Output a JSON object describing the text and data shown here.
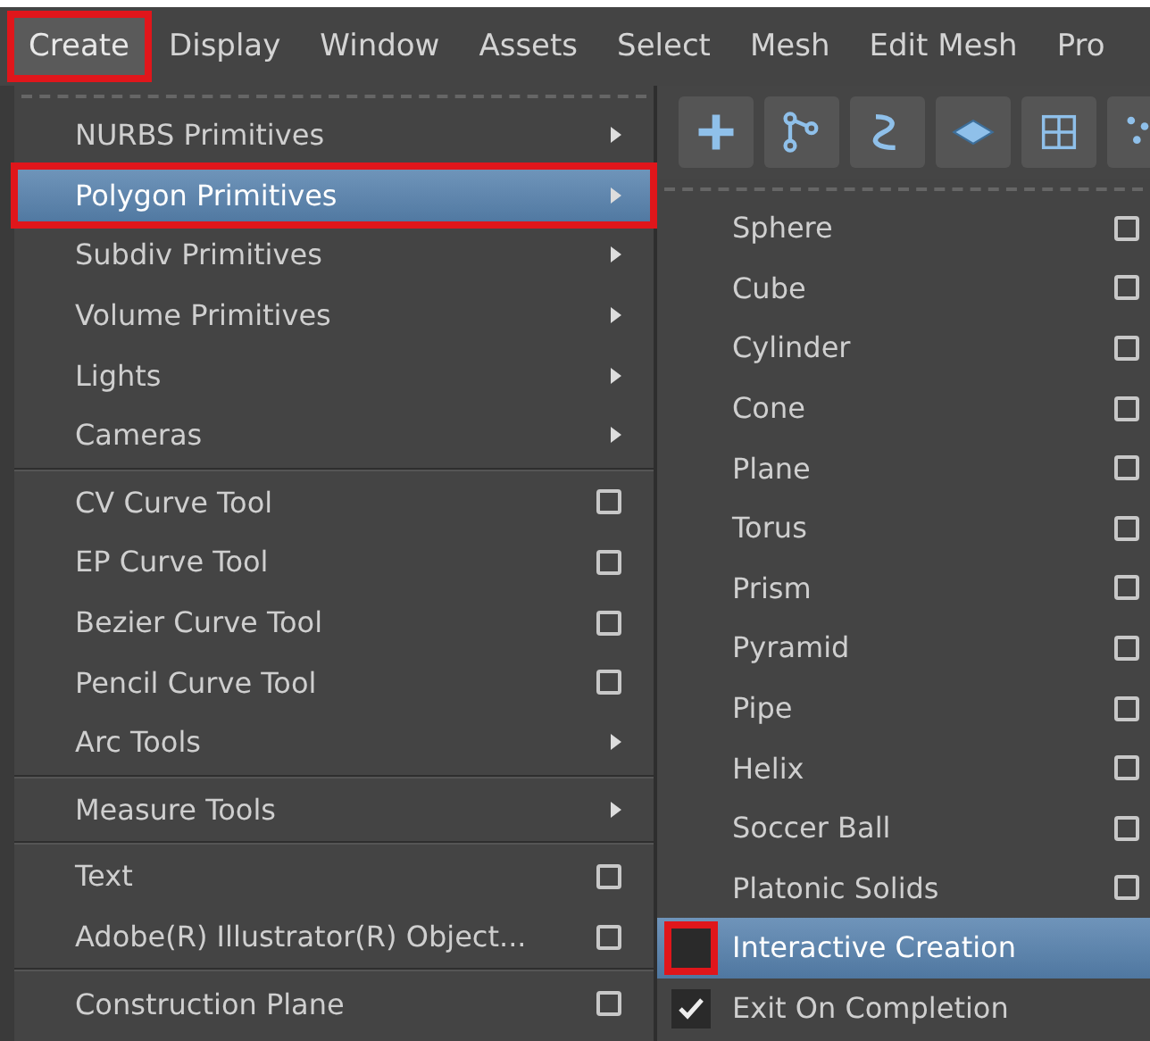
{
  "menu_bar": [
    {
      "label": "Create",
      "selected": true,
      "annotated": true
    },
    {
      "label": "Display",
      "selected": false,
      "annotated": false
    },
    {
      "label": "Window",
      "selected": false,
      "annotated": false
    },
    {
      "label": "Assets",
      "selected": false,
      "annotated": false
    },
    {
      "label": "Select",
      "selected": false,
      "annotated": false
    },
    {
      "label": "Mesh",
      "selected": false,
      "annotated": false
    },
    {
      "label": "Edit Mesh",
      "selected": false,
      "annotated": false
    },
    {
      "label": "Pro",
      "selected": false,
      "annotated": false
    }
  ],
  "create_menu": {
    "sections": [
      [
        {
          "label": "NURBS Primitives",
          "kind": "submenu",
          "highlighted": false,
          "annotated": false
        },
        {
          "label": "Polygon Primitives",
          "kind": "submenu",
          "highlighted": true,
          "annotated": true
        },
        {
          "label": "Subdiv Primitives",
          "kind": "submenu",
          "highlighted": false,
          "annotated": false
        },
        {
          "label": "Volume Primitives",
          "kind": "submenu",
          "highlighted": false,
          "annotated": false
        },
        {
          "label": "Lights",
          "kind": "submenu",
          "highlighted": false,
          "annotated": false
        },
        {
          "label": "Cameras",
          "kind": "submenu",
          "highlighted": false,
          "annotated": false
        }
      ],
      [
        {
          "label": "CV Curve Tool",
          "kind": "option",
          "highlighted": false,
          "annotated": false
        },
        {
          "label": "EP Curve Tool",
          "kind": "option",
          "highlighted": false,
          "annotated": false
        },
        {
          "label": "Bezier Curve Tool",
          "kind": "option",
          "highlighted": false,
          "annotated": false
        },
        {
          "label": "Pencil Curve Tool",
          "kind": "option",
          "highlighted": false,
          "annotated": false
        },
        {
          "label": "Arc Tools",
          "kind": "submenu",
          "highlighted": false,
          "annotated": false
        }
      ],
      [
        {
          "label": "Measure Tools",
          "kind": "submenu",
          "highlighted": false,
          "annotated": false
        }
      ],
      [
        {
          "label": "Text",
          "kind": "option",
          "highlighted": false,
          "annotated": false
        },
        {
          "label": "Adobe(R) Illustrator(R) Object...",
          "kind": "option",
          "highlighted": false,
          "annotated": false
        }
      ],
      [
        {
          "label": "Construction Plane",
          "kind": "option",
          "highlighted": false,
          "annotated": false
        }
      ]
    ]
  },
  "polygon_submenu": {
    "items": [
      {
        "label": "Sphere",
        "kind": "option",
        "highlighted": false
      },
      {
        "label": "Cube",
        "kind": "option",
        "highlighted": false
      },
      {
        "label": "Cylinder",
        "kind": "option",
        "highlighted": false
      },
      {
        "label": "Cone",
        "kind": "option",
        "highlighted": false
      },
      {
        "label": "Plane",
        "kind": "option",
        "highlighted": false
      },
      {
        "label": "Torus",
        "kind": "option",
        "highlighted": false
      },
      {
        "label": "Prism",
        "kind": "option",
        "highlighted": false
      },
      {
        "label": "Pyramid",
        "kind": "option",
        "highlighted": false
      },
      {
        "label": "Pipe",
        "kind": "option",
        "highlighted": false
      },
      {
        "label": "Helix",
        "kind": "option",
        "highlighted": false
      },
      {
        "label": "Soccer Ball",
        "kind": "option",
        "highlighted": false
      },
      {
        "label": "Platonic Solids",
        "kind": "option",
        "highlighted": false
      },
      {
        "label": "Interactive Creation",
        "kind": "toggle",
        "checked": false,
        "highlighted": true,
        "annotated": true
      },
      {
        "label": "Exit On Completion",
        "kind": "toggle",
        "checked": true,
        "highlighted": false
      }
    ]
  }
}
